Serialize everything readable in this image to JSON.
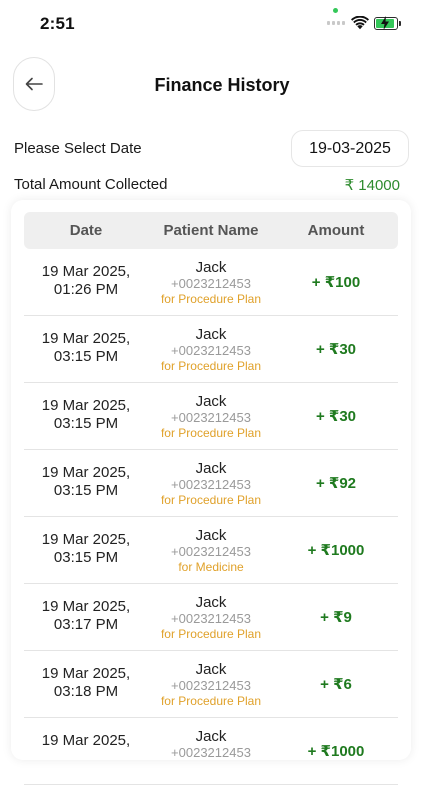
{
  "status_bar": {
    "time": "2:51"
  },
  "header": {
    "title": "Finance History"
  },
  "filter": {
    "date_label": "Please Select Date",
    "date_value": "19-03-2025",
    "total_label": "Total Amount Collected",
    "total_value": "₹ 14000"
  },
  "table": {
    "headers": [
      "Date",
      "Patient Name",
      "Amount"
    ],
    "rows": [
      {
        "date_line1": "19 Mar 2025,",
        "date_line2": "01:26 PM",
        "name": "Jack",
        "phone": "+0023212453",
        "purpose": "for Procedure Plan",
        "amount": "+ ₹100"
      },
      {
        "date_line1": "19 Mar 2025,",
        "date_line2": "03:15 PM",
        "name": "Jack",
        "phone": "+0023212453",
        "purpose": "for Procedure Plan",
        "amount": "+ ₹30"
      },
      {
        "date_line1": "19 Mar 2025,",
        "date_line2": "03:15 PM",
        "name": "Jack",
        "phone": "+0023212453",
        "purpose": "for Procedure Plan",
        "amount": "+ ₹30"
      },
      {
        "date_line1": "19 Mar 2025,",
        "date_line2": "03:15 PM",
        "name": "Jack",
        "phone": "+0023212453",
        "purpose": "for Procedure Plan",
        "amount": "+ ₹92"
      },
      {
        "date_line1": "19 Mar 2025,",
        "date_line2": "03:15 PM",
        "name": "Jack",
        "phone": "+0023212453",
        "purpose": "for Medicine",
        "amount": "+ ₹1000"
      },
      {
        "date_line1": "19 Mar 2025,",
        "date_line2": "03:17 PM",
        "name": "Jack",
        "phone": "+0023212453",
        "purpose": "for Procedure Plan",
        "amount": "+ ₹9"
      },
      {
        "date_line1": "19 Mar 2025,",
        "date_line2": "03:18 PM",
        "name": "Jack",
        "phone": "+0023212453",
        "purpose": "for Procedure Plan",
        "amount": "+ ₹6"
      },
      {
        "date_line1": "19 Mar 2025,",
        "date_line2": "",
        "name": "Jack",
        "phone": "+0023212453",
        "purpose": "",
        "amount": "+ ₹1000"
      }
    ]
  },
  "icons": {
    "back": "arrow-left-icon",
    "wifi": "wifi-icon",
    "battery": "battery-charging-icon",
    "signal": "cellular-signal-icon"
  },
  "colors": {
    "amount_green": "#1f7a1f",
    "total_green": "#2e8b2e",
    "purpose_orange": "#e0a12a",
    "phone_gray": "#9a9a9a",
    "header_bg": "#efefef"
  }
}
